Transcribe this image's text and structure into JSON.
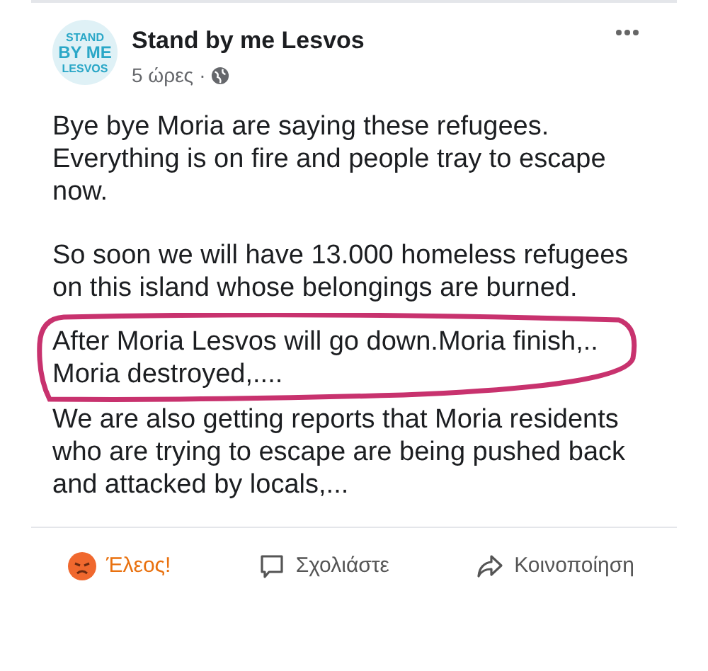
{
  "post": {
    "author": "Stand by me Lesvos",
    "avatar_text": [
      "STAND",
      "BY ME",
      "LESVOS"
    ],
    "time": "5 ώρες",
    "separator": "·",
    "paragraphs": [
      {
        "text": "Bye bye Moria are saying these refugees. Everything is on fire and people tray to escape now.",
        "circled": false
      },
      {
        "text": "So soon we will have 13.000 homeless refugees on this island whose belongings are burned.",
        "circled": false
      },
      {
        "text": "After Moria Lesvos will go down.Moria finish,.. Moria destroyed,....",
        "circled": true
      },
      {
        "text": "We are also getting reports that Moria residents who are trying to escape are being pushed back and attacked by locals,...",
        "circled": false
      }
    ]
  },
  "actions": [
    {
      "kind": "reaction",
      "label": "Έλεος!",
      "selected": true
    },
    {
      "kind": "comment",
      "label": "Σχολιάστε",
      "selected": false
    },
    {
      "kind": "share",
      "label": "Κοινοποίηση",
      "selected": false
    }
  ]
}
